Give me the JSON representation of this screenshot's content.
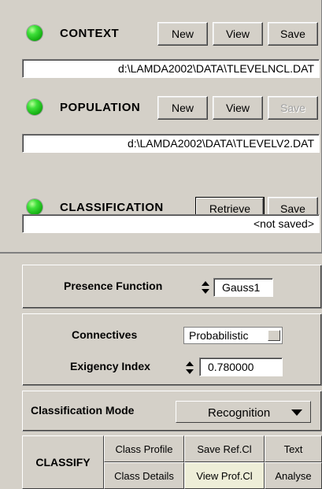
{
  "context": {
    "title": "CONTEXT",
    "buttons": {
      "new": "New",
      "view": "View",
      "save": "Save"
    },
    "path": "d:\\LAMDA2002\\DATA\\TLEVELNCL.DAT",
    "status_color": "#2ad126"
  },
  "population": {
    "title": "POPULATION",
    "buttons": {
      "new": "New",
      "view": "View",
      "save": "Save"
    },
    "path": "d:\\LAMDA2002\\DATA\\TLEVELV2.DAT",
    "status_color": "#2ad126"
  },
  "classification": {
    "title": "CLASSIFICATION",
    "buttons": {
      "retrieve": "Retrieve",
      "save": "Save"
    },
    "path": "<not saved>",
    "status_color": "#2ad126"
  },
  "presence": {
    "label": "Presence Function",
    "value": "Gauss1"
  },
  "connectives": {
    "label": "Connectives",
    "value": "Probabilistic"
  },
  "exigency": {
    "label": "Exigency Index",
    "value": "0.780000"
  },
  "mode": {
    "label": "Classification Mode",
    "value": "Recognition"
  },
  "classify": {
    "label": "CLASSIFY",
    "buttons": {
      "class_profile": "Class Profile",
      "save_ref": "Save Ref.Cl",
      "text": "Text",
      "class_details": "Class Details",
      "view_prof": "View Prof.Cl",
      "analyse": "Analyse"
    }
  }
}
